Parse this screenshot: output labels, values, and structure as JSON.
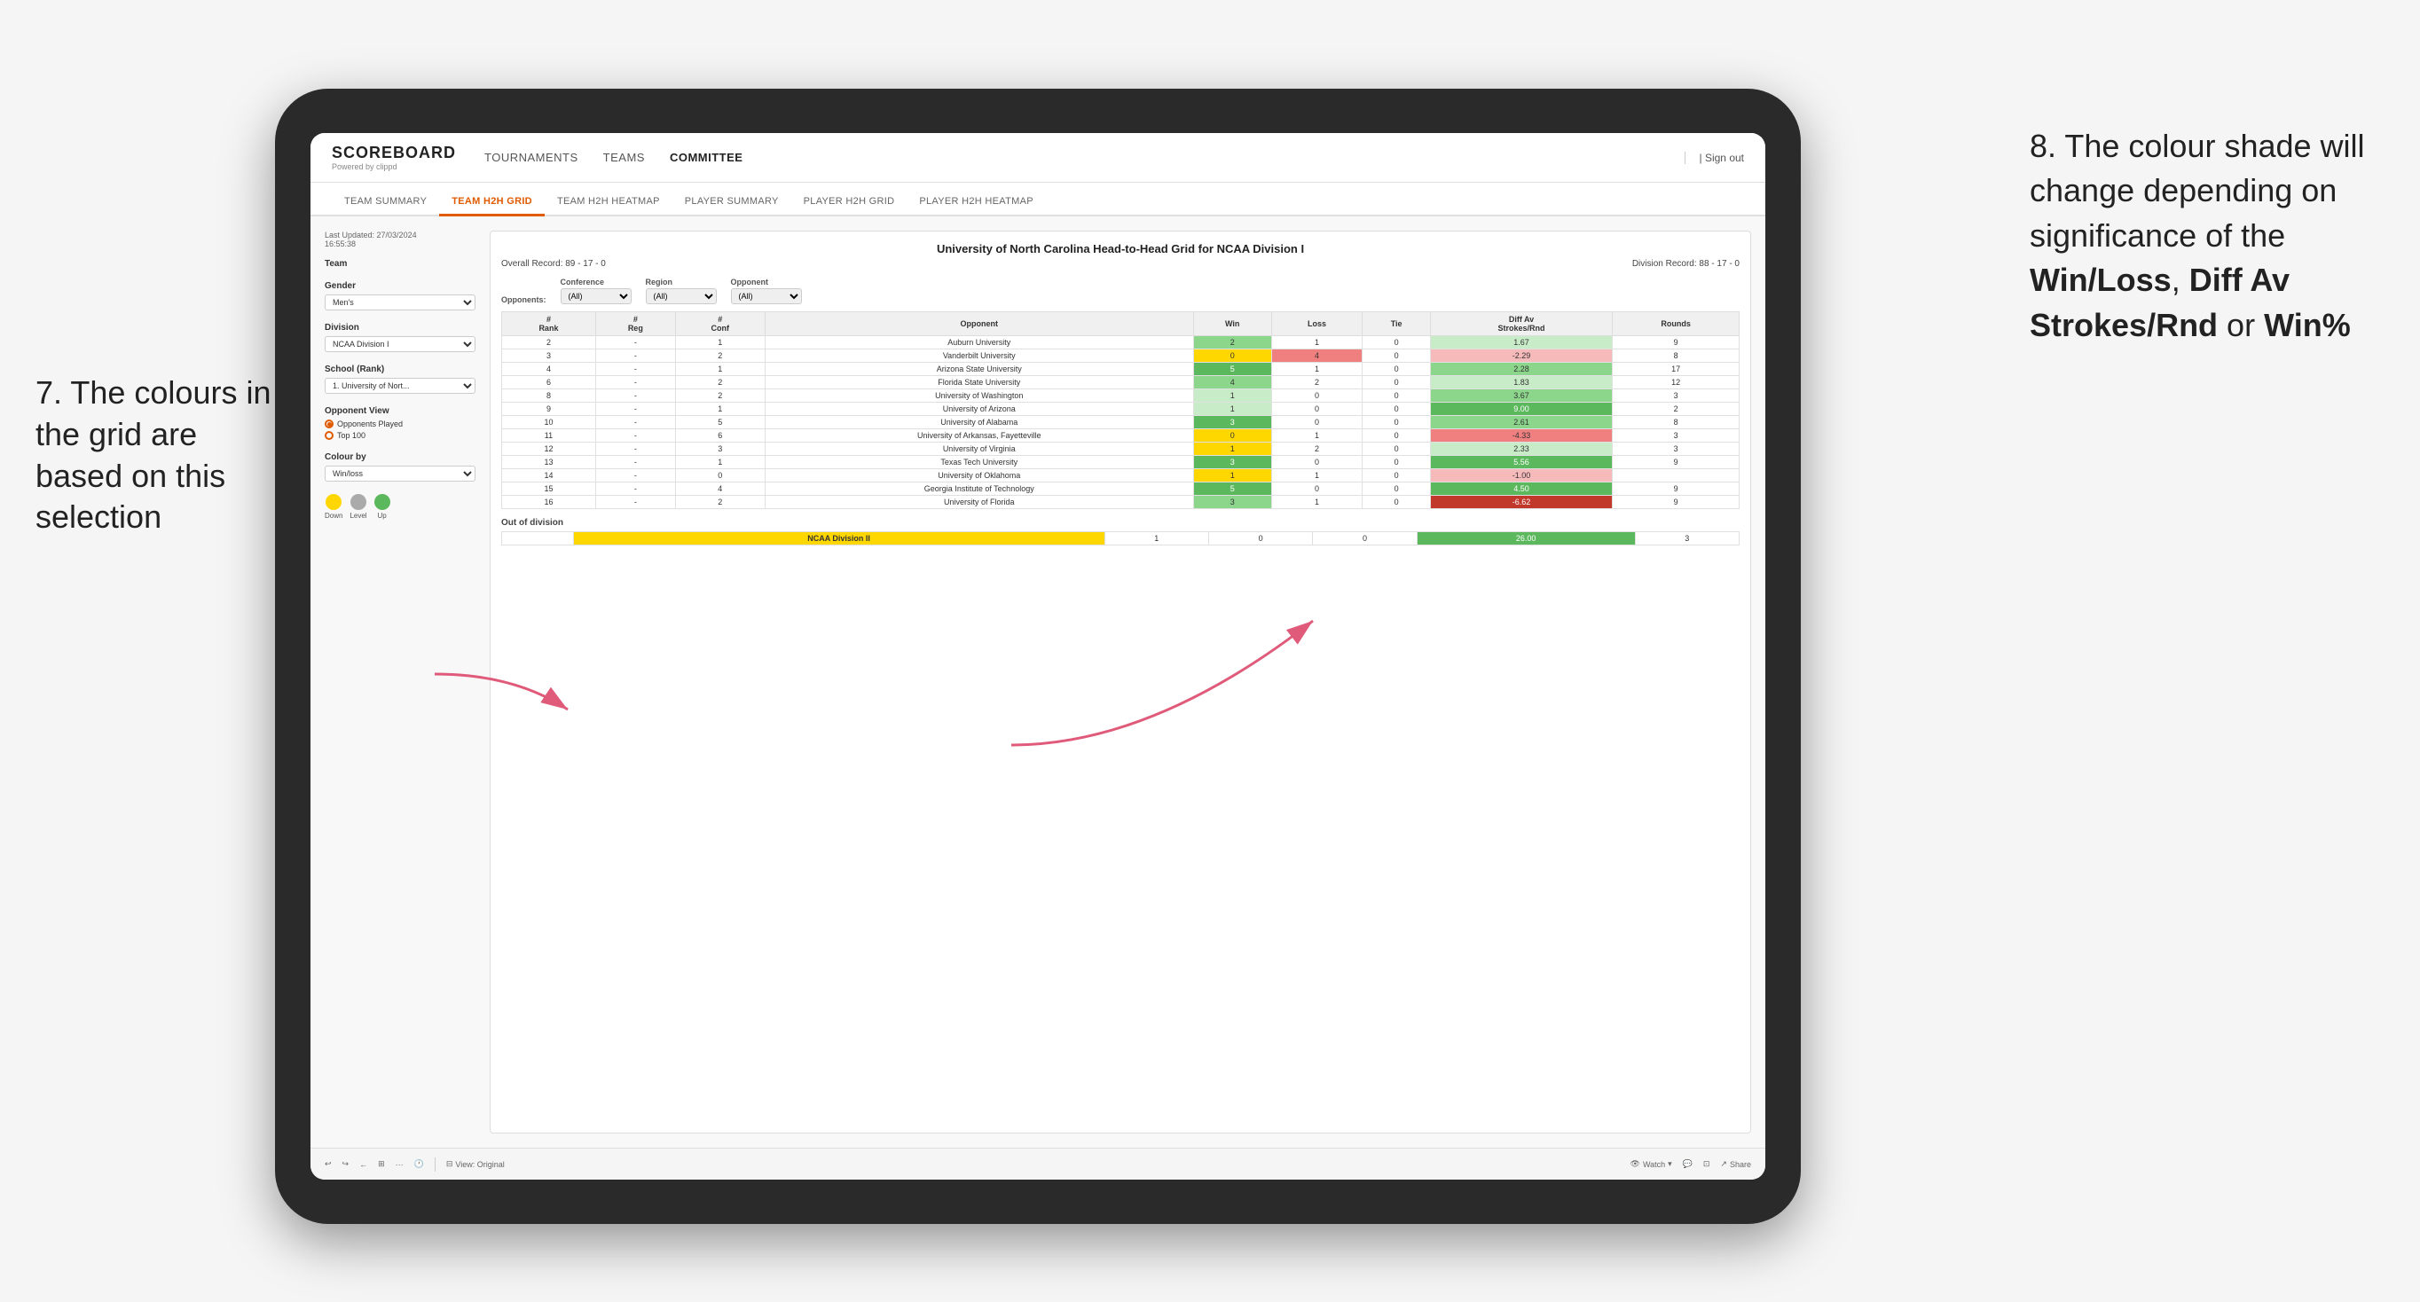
{
  "page": {
    "background": "#f5f5f5"
  },
  "annotation_left": "7. The colours in the grid are based on this selection",
  "annotation_right_parts": [
    "8. The colour shade will change depending on significance of the ",
    "Win/Loss",
    ", ",
    "Diff Av Strokes/Rnd",
    " or ",
    "Win%"
  ],
  "annotation_right_plain": "8. The colour shade will change depending on significance of the Win/Loss, Diff Av Strokes/Rnd or Win%",
  "nav": {
    "logo": "SCOREBOARD",
    "logo_sub": "Powered by clippd",
    "items": [
      "TOURNAMENTS",
      "TEAMS",
      "COMMITTEE"
    ],
    "active_item": "COMMITTEE",
    "sign_out": "Sign out"
  },
  "sub_tabs": [
    {
      "label": "TEAM SUMMARY",
      "active": false
    },
    {
      "label": "TEAM H2H GRID",
      "active": true
    },
    {
      "label": "TEAM H2H HEATMAP",
      "active": false
    },
    {
      "label": "PLAYER SUMMARY",
      "active": false
    },
    {
      "label": "PLAYER H2H GRID",
      "active": false
    },
    {
      "label": "PLAYER H2H HEATMAP",
      "active": false
    }
  ],
  "sidebar": {
    "last_updated_label": "Last Updated: 27/03/2024",
    "last_updated_time": "16:55:38",
    "team_label": "Team",
    "gender_label": "Gender",
    "gender_value": "Men's",
    "division_label": "Division",
    "division_value": "NCAA Division I",
    "school_label": "School (Rank)",
    "school_value": "1. University of Nort...",
    "opponent_view_label": "Opponent View",
    "radio_options": [
      "Opponents Played",
      "Top 100"
    ],
    "radio_selected": "Opponents Played",
    "colour_by_label": "Colour by",
    "colour_by_value": "Win/loss",
    "legend_down": "Down",
    "legend_level": "Level",
    "legend_up": "Up",
    "legend_colors": [
      "#ffd700",
      "#aaaaaa",
      "#5cb85c"
    ]
  },
  "grid": {
    "title": "University of North Carolina Head-to-Head Grid for NCAA Division I",
    "overall_record": "Overall Record: 89 - 17 - 0",
    "division_record": "Division Record: 88 - 17 - 0",
    "filters": {
      "opponents_label": "Opponents:",
      "conference_label": "Conference",
      "conference_value": "(All)",
      "region_label": "Region",
      "region_value": "(All)",
      "opponent_label": "Opponent",
      "opponent_value": "(All)"
    },
    "column_headers": [
      "#\nRank",
      "#\nReg",
      "#\nConf",
      "Opponent",
      "Win",
      "Loss",
      "Tie",
      "Diff Av\nStrokes/Rnd",
      "Rounds"
    ],
    "rows": [
      {
        "rank": "2",
        "reg": "-",
        "conf": "1",
        "opponent": "Auburn University",
        "win": "2",
        "loss": "1",
        "tie": "0",
        "diff": "1.67",
        "rounds": "9",
        "win_color": "green-mid",
        "diff_color": "green-light"
      },
      {
        "rank": "3",
        "reg": "-",
        "conf": "2",
        "opponent": "Vanderbilt University",
        "win": "0",
        "loss": "4",
        "tie": "0",
        "diff": "-2.29",
        "rounds": "8",
        "win_color": "red-mid",
        "diff_color": "red-light"
      },
      {
        "rank": "4",
        "reg": "-",
        "conf": "1",
        "opponent": "Arizona State University",
        "win": "5",
        "loss": "1",
        "tie": "0",
        "diff": "2.28",
        "rounds": "",
        "win_color": "green-dark",
        "diff_color": "green-mid"
      },
      {
        "rank": "6",
        "reg": "-",
        "conf": "2",
        "opponent": "Florida State University",
        "win": "4",
        "loss": "2",
        "tie": "0",
        "diff": "1.83",
        "rounds": "12",
        "win_color": "green-mid",
        "diff_color": "green-light"
      },
      {
        "rank": "8",
        "reg": "-",
        "conf": "2",
        "opponent": "University of Washington",
        "win": "1",
        "loss": "0",
        "tie": "0",
        "diff": "3.67",
        "rounds": "3",
        "win_color": "green-light",
        "diff_color": "green-mid"
      },
      {
        "rank": "9",
        "reg": "-",
        "conf": "1",
        "opponent": "University of Arizona",
        "win": "1",
        "loss": "0",
        "tie": "0",
        "diff": "9.00",
        "rounds": "2",
        "win_color": "green-light",
        "diff_color": "green-dark"
      },
      {
        "rank": "10",
        "reg": "-",
        "conf": "5",
        "opponent": "University of Alabama",
        "win": "3",
        "loss": "0",
        "tie": "0",
        "diff": "2.61",
        "rounds": "8",
        "win_color": "green-dark",
        "diff_color": "green-mid"
      },
      {
        "rank": "11",
        "reg": "-",
        "conf": "6",
        "opponent": "University of Arkansas, Fayetteville",
        "win": "0",
        "loss": "1",
        "tie": "0",
        "diff": "-4.33",
        "rounds": "3",
        "win_color": "red-light",
        "diff_color": "red-mid"
      },
      {
        "rank": "12",
        "reg": "-",
        "conf": "3",
        "opponent": "University of Virginia",
        "win": "1",
        "loss": "2",
        "tie": "0",
        "diff": "2.33",
        "rounds": "3",
        "win_color": "yellow",
        "diff_color": "green-light"
      },
      {
        "rank": "13",
        "reg": "-",
        "conf": "1",
        "opponent": "Texas Tech University",
        "win": "3",
        "loss": "0",
        "tie": "0",
        "diff": "5.56",
        "rounds": "9",
        "win_color": "green-dark",
        "diff_color": "green-dark"
      },
      {
        "rank": "14",
        "reg": "-",
        "conf": "0",
        "opponent": "University of Oklahoma",
        "win": "1",
        "loss": "1",
        "tie": "0",
        "diff": "-1.00",
        "rounds": "",
        "win_color": "yellow",
        "diff_color": "red-light"
      },
      {
        "rank": "15",
        "reg": "-",
        "conf": "4",
        "opponent": "Georgia Institute of Technology",
        "win": "5",
        "loss": "0",
        "tie": "0",
        "diff": "4.50",
        "rounds": "9",
        "win_color": "green-dark",
        "diff_color": "green-dark"
      },
      {
        "rank": "16",
        "reg": "-",
        "conf": "2",
        "opponent": "University of Florida",
        "win": "3",
        "loss": "1",
        "tie": "0",
        "diff": "-6.62",
        "rounds": "9",
        "win_color": "green-mid",
        "diff_color": "red-dark"
      }
    ],
    "out_of_division_label": "Out of division",
    "out_of_division_row": {
      "label": "NCAA Division II",
      "win": "1",
      "loss": "0",
      "tie": "0",
      "diff": "26.00",
      "rounds": "3",
      "diff_color": "green-dark"
    }
  },
  "toolbar": {
    "view_label": "View: Original",
    "watch_label": "Watch",
    "share_label": "Share"
  }
}
